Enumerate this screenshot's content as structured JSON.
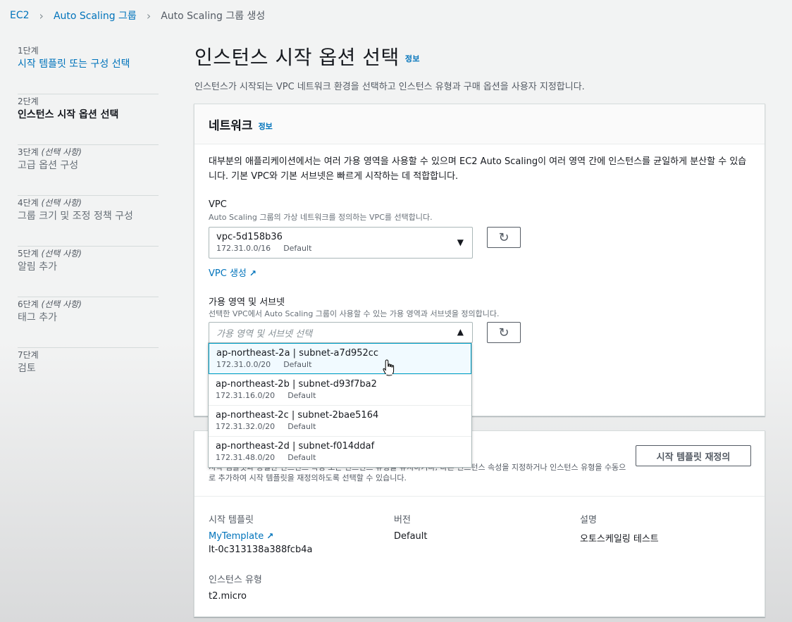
{
  "breadcrumb": {
    "ec2": "EC2",
    "asg": "Auto Scaling 그룹",
    "current": "Auto Scaling 그룹 생성"
  },
  "steps": [
    {
      "num": "1단계",
      "optional": "",
      "label": "시작 템플릿 또는 구성 선택",
      "state": "link"
    },
    {
      "num": "2단계",
      "optional": "",
      "label": "인스턴스 시작 옵션 선택",
      "state": "current"
    },
    {
      "num": "3단계",
      "optional": "(선택 사항)",
      "label": "고급 옵션 구성",
      "state": "disabled"
    },
    {
      "num": "4단계",
      "optional": "(선택 사항)",
      "label": "그룹 크기 및 조정 정책 구성",
      "state": "disabled"
    },
    {
      "num": "5단계",
      "optional": "(선택 사항)",
      "label": "알림 추가",
      "state": "disabled"
    },
    {
      "num": "6단계",
      "optional": "(선택 사항)",
      "label": "태그 추가",
      "state": "disabled"
    },
    {
      "num": "7단계",
      "optional": "",
      "label": "검토",
      "state": "disabled"
    }
  ],
  "page": {
    "title": "인스턴스 시작 옵션 선택",
    "info": "정보",
    "description": "인스턴스가 시작되는 VPC 네트워크 환경을 선택하고 인스턴스 유형과 구매 옵션을 사용자 지정합니다."
  },
  "network": {
    "title": "네트워크",
    "info": "정보",
    "intro": "대부분의 애플리케이션에서는 여러 가용 영역을 사용할 수 있으며 EC2 Auto Scaling이 여러 영역 간에 인스턴스를 균일하게 분산할 수 있습니다. 기본 VPC와 기본 서브넷은 빠르게 시작하는 데 적합합니다.",
    "vpc_label": "VPC",
    "vpc_desc": "Auto Scaling 그룹의 가상 네트워크를 정의하는 VPC를 선택합니다.",
    "vpc_value": "vpc-5d158b36",
    "vpc_cidr": "172.31.0.0/16",
    "vpc_tag": "Default",
    "vpc_create": "VPC 생성",
    "az_label": "가용 영역 및 서브넷",
    "az_desc": "선택한 VPC에서 Auto Scaling 그룹이 사용할 수 있는 가용 영역과 서브넷을 정의합니다.",
    "az_placeholder": "가용 영역 및 서브넷 선택",
    "az_options": [
      {
        "name": "ap-northeast-2a | subnet-a7d952cc",
        "cidr": "172.31.0.0/20",
        "tag": "Default"
      },
      {
        "name": "ap-northeast-2b | subnet-d93f7ba2",
        "cidr": "172.31.16.0/20",
        "tag": "Default"
      },
      {
        "name": "ap-northeast-2c | subnet-2bae5164",
        "cidr": "172.31.32.0/20",
        "tag": "Default"
      },
      {
        "name": "ap-northeast-2d | subnet-f014ddaf",
        "cidr": "172.31.48.0/20",
        "tag": "Default"
      }
    ]
  },
  "template": {
    "override_button": "시작 템플릿 재정의",
    "description": "시작 템플릿과 동일한 인스턴스 속성 또는 인스턴스 유형을 유지하거나, 다른 인스턴스 속성을 지정하거나 인스턴스 유형을 수동으로 추가하여 시작 템플릿을 재정의하도록 선택할 수 있습니다.",
    "launch_template_key": "시작 템플릿",
    "launch_template_name": "MyTemplate",
    "launch_template_id": "lt-0c313138a388fcb4a",
    "version_key": "버전",
    "version_value": "Default",
    "desc_key": "설명",
    "desc_value": "오토스케일링 테스트",
    "instance_type_key": "인스턴스 유형",
    "instance_type_value": "t2.micro"
  }
}
